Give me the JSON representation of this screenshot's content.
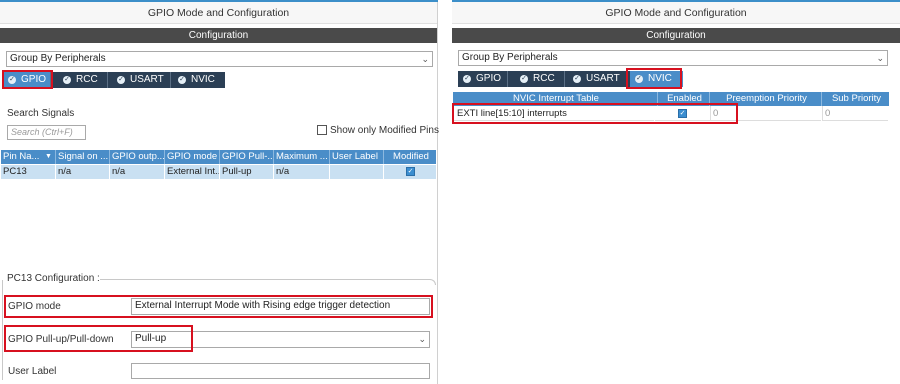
{
  "left": {
    "title": "GPIO Mode and Configuration",
    "config_bar": "Configuration",
    "group_select": "Group By Peripherals",
    "tabs": [
      {
        "label": "GPIO",
        "icon": "check-circle-icon",
        "active": true
      },
      {
        "label": "RCC",
        "icon": "check-circle-icon",
        "active": false
      },
      {
        "label": "USART",
        "icon": "check-circle-icon",
        "active": false
      },
      {
        "label": "NVIC",
        "icon": "check-circle-icon",
        "active": false
      }
    ],
    "search_label": "Search Signals",
    "search_placeholder": "Search (Ctrl+F)",
    "show_modified": "Show only Modified Pins",
    "columns": [
      "Pin Na...",
      "Signal on ...",
      "GPIO outp...",
      "GPIO mode",
      "GPIO Pull-...",
      "Maximum ...",
      "User Label",
      "Modified"
    ],
    "row": [
      "PC13",
      "n/a",
      "n/a",
      "External Int...",
      "Pull-up",
      "n/a",
      "",
      ""
    ],
    "pc13_config_title": "PC13 Configuration :",
    "gpio_mode_label": "GPIO mode",
    "gpio_mode_value": "External Interrupt Mode with Rising edge trigger detection",
    "gpio_pull_label": "GPIO Pull-up/Pull-down",
    "gpio_pull_value": "Pull-up",
    "user_label_label": "User Label",
    "user_label_value": ""
  },
  "right": {
    "title": "GPIO Mode and Configuration",
    "config_bar": "Configuration",
    "group_select": "Group By Peripherals",
    "tabs": [
      {
        "label": "GPIO",
        "icon": "check-circle-icon",
        "active": false
      },
      {
        "label": "RCC",
        "icon": "check-circle-icon",
        "active": false
      },
      {
        "label": "USART",
        "icon": "check-circle-icon",
        "active": false
      },
      {
        "label": "NVIC",
        "icon": "check-circle-icon",
        "active": true
      }
    ],
    "columns": [
      "NVIC Interrupt Table",
      "Enabled",
      "Preemption Priority",
      "Sub Priority"
    ],
    "row": [
      "EXTI line[15:10] interrupts",
      "",
      "0",
      "0"
    ]
  },
  "colors": {
    "accent": "#4a8dc8",
    "tab_bar": "#2b3f55",
    "config_bar": "#4a4a4a",
    "highlight_box": "#d7101f",
    "row_selected": "#c9e0f2"
  }
}
